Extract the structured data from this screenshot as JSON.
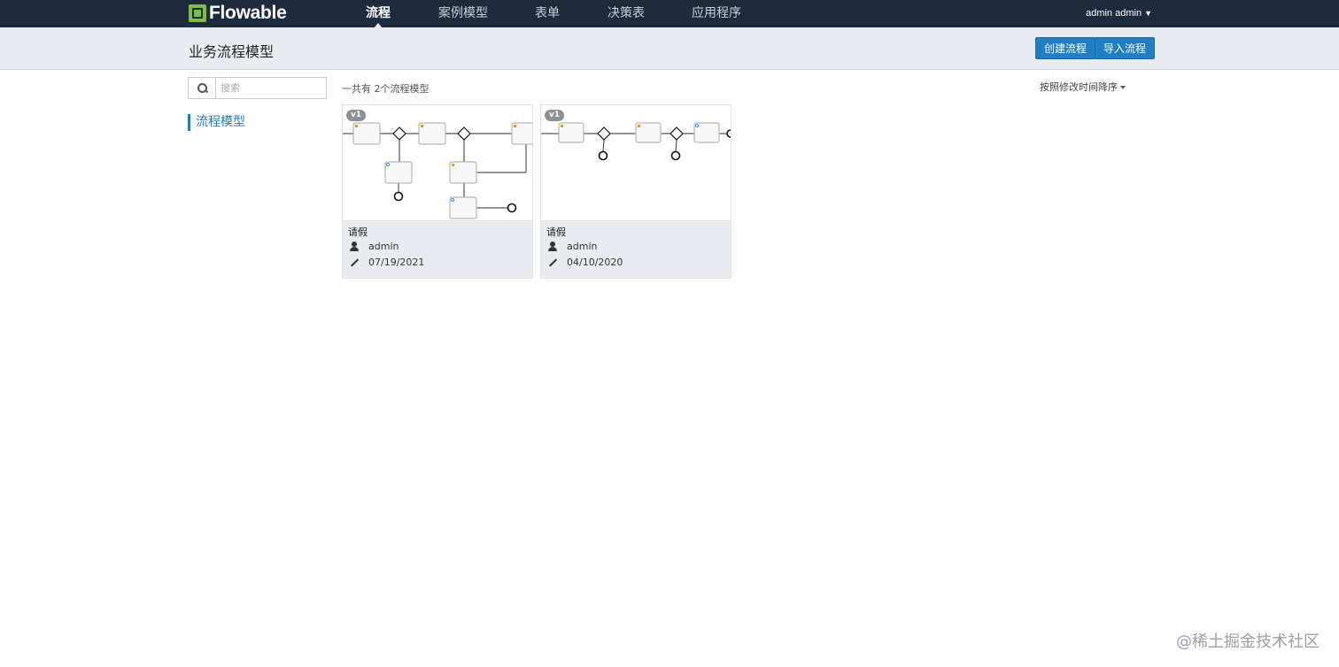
{
  "topbar": {
    "logo_text": "Flowable",
    "nav": [
      {
        "label": "流程",
        "active": true
      },
      {
        "label": "案例模型",
        "active": false
      },
      {
        "label": "表单",
        "active": false
      },
      {
        "label": "决策表",
        "active": false
      },
      {
        "label": "应用程序",
        "active": false
      }
    ],
    "user_label": "admin admin",
    "user_chevron": "chevron-down-icon"
  },
  "subheader": {
    "title": "业务流程模型",
    "create_button": "创建流程",
    "import_button": "导入流程"
  },
  "sidebar": {
    "search_placeholder": "搜索",
    "items": [
      {
        "label": "流程模型",
        "active": true
      }
    ]
  },
  "content": {
    "count_text": "一共有 2个流程模型",
    "sort_label": "按照修改时间降序",
    "cards": [
      {
        "version": "v1",
        "name": "请假",
        "user": "admin",
        "date": "07/19/2021"
      },
      {
        "version": "v1",
        "name": "请假",
        "user": "admin",
        "date": "04/10/2020"
      }
    ]
  },
  "watermark": "@稀土掘金技术社区",
  "colors": {
    "topbar_bg": "#1d2b3c",
    "accent": "#1f7fc2",
    "logo_green": "#7cc142",
    "subheader_bg": "#e8ecf0"
  }
}
